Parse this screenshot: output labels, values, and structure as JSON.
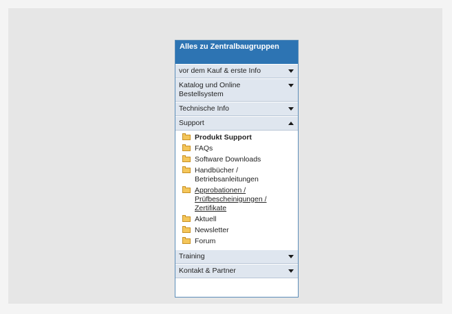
{
  "panel": {
    "title": "Alles zu Zentralbaugruppen"
  },
  "sections_top": [
    {
      "label": "vor dem Kauf & erste Info",
      "state": "collapsed"
    },
    {
      "label": "Katalog und Online Bestellsystem",
      "state": "collapsed"
    },
    {
      "label": "Technische Info",
      "state": "collapsed"
    }
  ],
  "support": {
    "label": "Support",
    "state": "expanded",
    "items": [
      {
        "label": "Produkt Support",
        "style": "bold"
      },
      {
        "label": "FAQs"
      },
      {
        "label": "Software Downloads"
      },
      {
        "label": "Handbücher / Betriebsanleitungen"
      },
      {
        "label": "Approbationen / Prüfbescheinigungen / Zertifikate",
        "style": "underline"
      },
      {
        "label": "Aktuell"
      },
      {
        "label": "Newsletter"
      },
      {
        "label": "Forum"
      }
    ]
  },
  "sections_bottom": [
    {
      "label": "Training",
      "state": "collapsed"
    },
    {
      "label": "Kontakt & Partner",
      "state": "collapsed"
    }
  ],
  "icons": {
    "section_collapsed": "triangle-down-icon",
    "section_expanded": "triangle-up-icon",
    "item": "folder-icon"
  },
  "colors": {
    "title_bg": "#2d74b3",
    "section_bg": "#dfe6ef",
    "folder": "#f4c65a"
  }
}
